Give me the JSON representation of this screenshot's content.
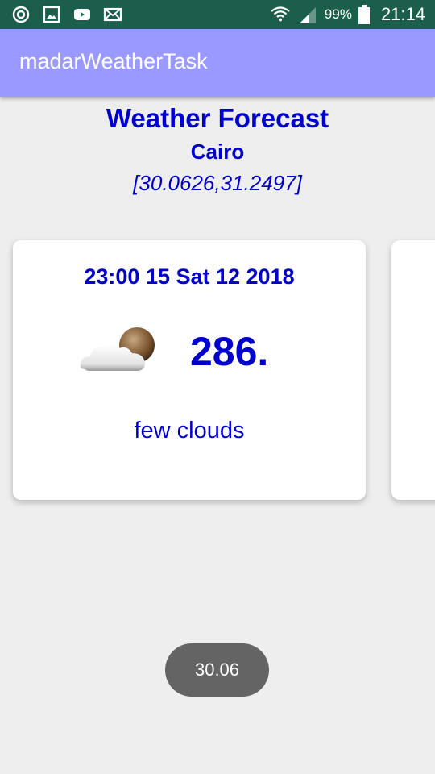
{
  "status_bar": {
    "battery_percent": "99%",
    "time": "21:14",
    "left_icons": [
      "sync-icon",
      "image-icon",
      "youtube-icon",
      "mail-icon"
    ],
    "right_icons": [
      "wifi-icon",
      "signal-icon",
      "battery-icon"
    ],
    "battery_level": 0.99
  },
  "app_bar": {
    "title": "madarWeatherTask"
  },
  "header": {
    "title": "Weather Forecast",
    "city": "Cairo",
    "coords": "[30.0626,31.2497]"
  },
  "forecast_card": {
    "datetime": "23:00 15 Sat 12 2018",
    "icon": "partly-cloudy-night-icon",
    "temperature": "286.",
    "description": "few clouds"
  },
  "toast": {
    "text": "30.06"
  },
  "colors": {
    "status_bar": "#1b5e4b",
    "app_bar": "#9999ff",
    "text_primary": "#0000cc",
    "background": "#eeeeee",
    "toast": "#646464"
  }
}
